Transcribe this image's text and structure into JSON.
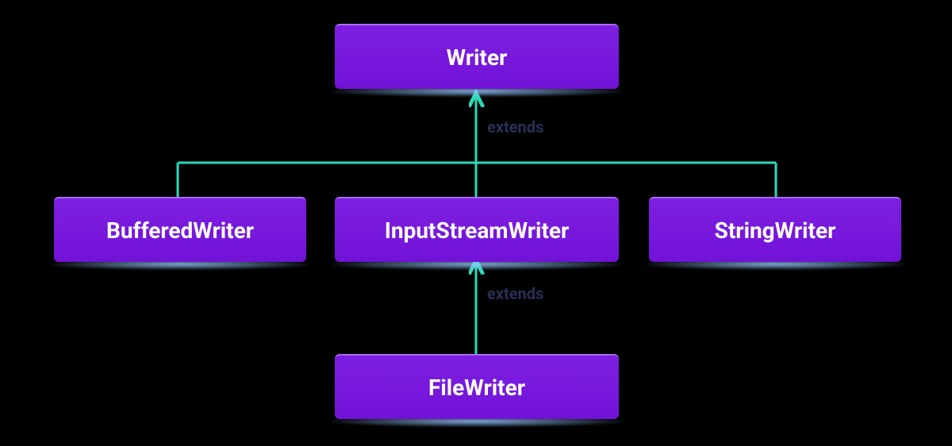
{
  "diagram": {
    "root": {
      "label": "Writer"
    },
    "children": [
      {
        "label": "BufferedWriter"
      },
      {
        "label": "InputStreamWriter"
      },
      {
        "label": "StringWriter"
      }
    ],
    "grandchild": {
      "label": "FileWriter"
    },
    "edge_label_top": "extends",
    "edge_label_bottom": "extends"
  },
  "colors": {
    "node_fill": "#7212d8",
    "node_highlight": "#a96bf1",
    "line": "#2bd9b8",
    "label_text": "#2a2f55",
    "glow": "#a5d0ff"
  }
}
